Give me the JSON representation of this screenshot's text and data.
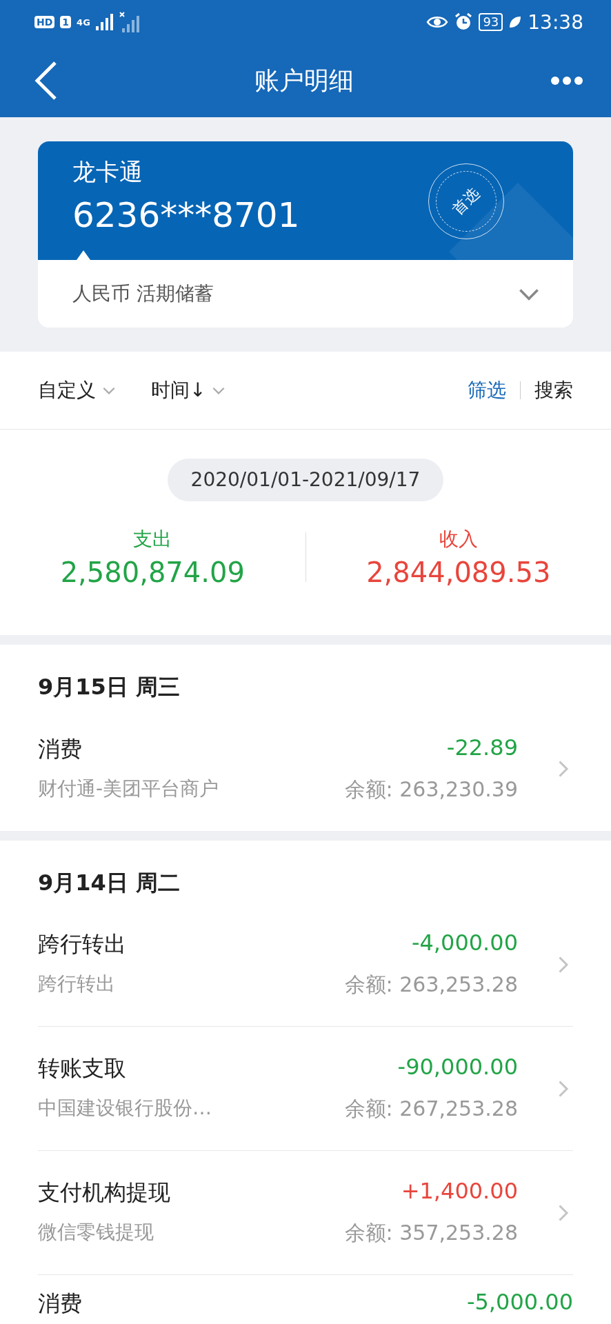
{
  "status_bar": {
    "hd": "HD",
    "sim": "1",
    "network": "4G",
    "battery": "93",
    "time": "13:38"
  },
  "header": {
    "title": "账户明细"
  },
  "card": {
    "name": "龙卡通",
    "number": "6236***8701",
    "stamp": "首选",
    "account_type": "人民币 活期储蓄"
  },
  "filters": {
    "left": [
      {
        "label": "自定义"
      },
      {
        "label": "时间↓"
      }
    ],
    "filter": "筛选",
    "search": "搜索"
  },
  "summary": {
    "date_range": "2020/01/01-2021/09/17",
    "stats": [
      {
        "label": "支出",
        "amount": "2,580,874.09",
        "income": false
      },
      {
        "label": "收入",
        "amount": "2,844,089.53",
        "income": true
      }
    ]
  },
  "days": [
    {
      "date": "9月15日 周三",
      "transactions": [
        {
          "title": "消费",
          "amount": "-22.89",
          "income": false,
          "description": "财付通-美团平台商户",
          "balance": "余额: 263,230.39"
        }
      ]
    },
    {
      "date": "9月14日 周二",
      "transactions": [
        {
          "title": "跨行转出",
          "amount": "-4,000.00",
          "income": false,
          "description": "跨行转出",
          "balance": "余额: 263,253.28"
        },
        {
          "title": "转账支取",
          "amount": "-90,000.00",
          "income": false,
          "description": "中国建设银行股份…",
          "balance": "余额: 267,253.28"
        },
        {
          "title": "支付机构提现",
          "amount": "+1,400.00",
          "income": true,
          "description": "微信零钱提现",
          "balance": "余额: 357,253.28"
        },
        {
          "title": "消费",
          "amount": "-5,000.00",
          "income": false
        }
      ]
    }
  ]
}
